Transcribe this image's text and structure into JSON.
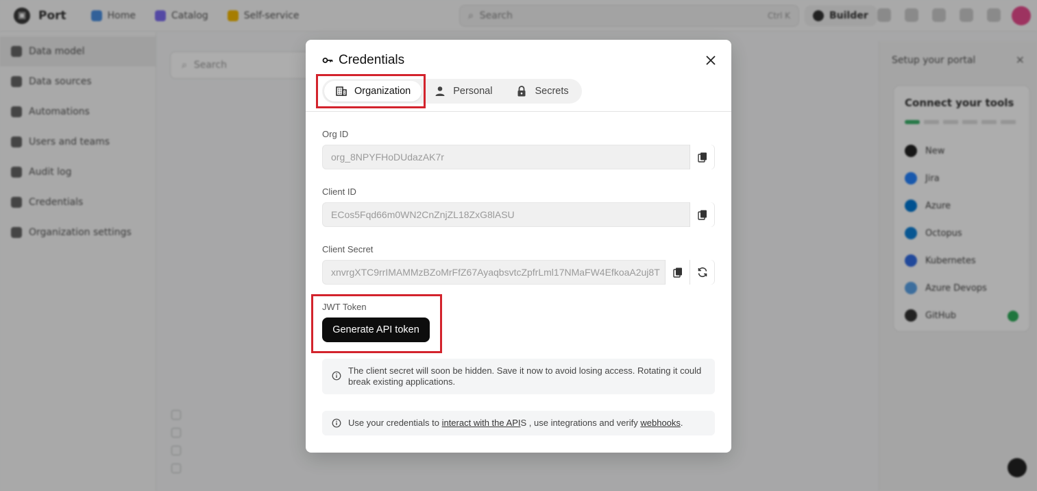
{
  "app": {
    "brand": "Port",
    "nav": [
      {
        "label": "Home",
        "color": "#4a90e2"
      },
      {
        "label": "Catalog",
        "color": "#7c6cf2"
      },
      {
        "label": "Self-service",
        "color": "#f5b800"
      }
    ],
    "search_placeholder": "Search",
    "search_shortcut": "Ctrl K",
    "builder_label": "Builder"
  },
  "sidebar": {
    "items": [
      {
        "label": "Data model"
      },
      {
        "label": "Data sources"
      },
      {
        "label": "Automations"
      },
      {
        "label": "Users and teams"
      },
      {
        "label": "Audit log"
      },
      {
        "label": "Credentials"
      },
      {
        "label": "Organization settings"
      }
    ]
  },
  "canvas": {
    "search_placeholder": "Search"
  },
  "setup": {
    "title": "Setup your portal",
    "card_title": "Connect your tools",
    "tools": [
      {
        "name": "New",
        "color": "#222222"
      },
      {
        "name": "Jira",
        "color": "#2684ff"
      },
      {
        "name": "Azure",
        "color": "#0078d4"
      },
      {
        "name": "Octopus",
        "color": "#0d80d8"
      },
      {
        "name": "Kubernetes",
        "color": "#326ce5"
      },
      {
        "name": "Azure Devops",
        "color": "#5aa3e8"
      },
      {
        "name": "GitHub",
        "color": "#333333"
      }
    ]
  },
  "modal": {
    "title": "Credentials",
    "tabs": [
      {
        "label": "Organization",
        "icon": "building-icon",
        "active": true
      },
      {
        "label": "Personal",
        "icon": "person-icon",
        "active": false
      },
      {
        "label": "Secrets",
        "icon": "lock-icon",
        "active": false
      }
    ],
    "org_id": {
      "label": "Org ID",
      "value": "org_8NPYFHoDUdazAK7r"
    },
    "client_id": {
      "label": "Client ID",
      "value": "ECos5Fqd66m0WN2CnZnjZL18ZxG8lASU"
    },
    "client_secret": {
      "label": "Client Secret",
      "value": "xnvrgXTC9rrIMAMMzBZoMrFfZ67AyaqbsvtcZpfrLml17NMaFW4EfkoaA2uj8T"
    },
    "jwt": {
      "label": "JWT Token",
      "button": "Generate API token"
    },
    "notice_secret": "The client secret will soon be hidden. Save it now to avoid losing access. Rotating it could break existing applications.",
    "notice_usage": {
      "prefix": "Use your credentials to ",
      "link_api": "interact with the API",
      "middle": "S , use integrations and verify ",
      "link_webhooks": "webhooks",
      "suffix": "."
    }
  },
  "colors": {
    "highlight": "#d3232c",
    "primary_button": "#0d0d0d"
  }
}
